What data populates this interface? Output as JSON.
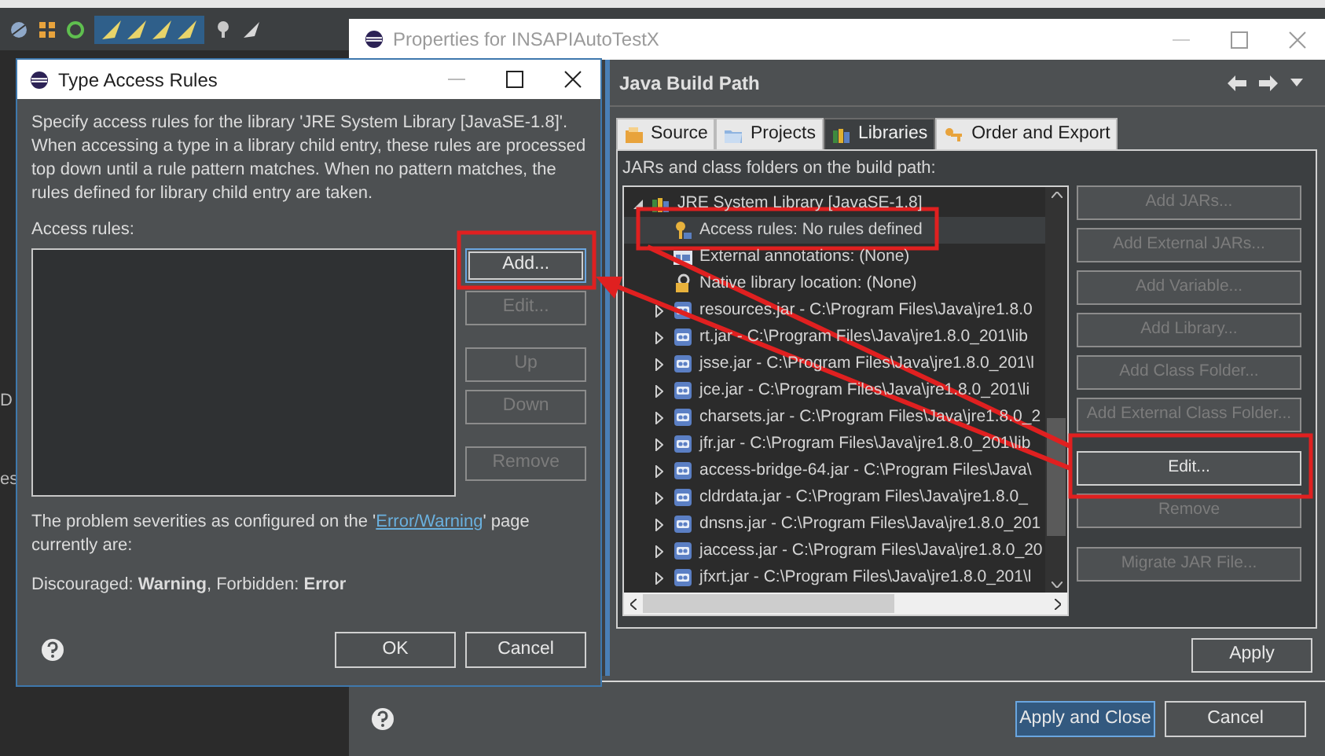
{
  "background": {
    "edge_texts": [
      "D",
      "es"
    ]
  },
  "properties_window": {
    "title": "Properties for INSAPIAutoTestX",
    "page_title": "Java Build Path",
    "tabs": [
      {
        "label": "Source",
        "kind": "source",
        "selected": false
      },
      {
        "label": "Projects",
        "kind": "projects",
        "selected": false
      },
      {
        "label": "Libraries",
        "kind": "libraries",
        "selected": true
      },
      {
        "label": "Order and Export",
        "kind": "order",
        "selected": false
      }
    ],
    "list_label": "JARs and class folders on the build path:",
    "tree": [
      {
        "label": "JRE System Library [JavaSE-1.8]",
        "kind": "library",
        "expanded": true,
        "selected": false,
        "children": [
          {
            "label": "Access rules: No rules defined",
            "kind": "rules",
            "selected": true
          },
          {
            "label": "External annotations: (None)",
            "kind": "annotations",
            "selected": false
          },
          {
            "label": "Native library location: (None)",
            "kind": "native",
            "selected": false
          },
          {
            "label": "resources.jar - C:\\Program Files\\Java\\jre1.8.0",
            "kind": "jar",
            "expanded": false,
            "selected": false
          },
          {
            "label": "rt.jar - C:\\Program Files\\Java\\jre1.8.0_201\\lib",
            "kind": "jar",
            "expanded": false,
            "selected": false
          },
          {
            "label": "jsse.jar - C:\\Program Files\\Java\\jre1.8.0_201\\l",
            "kind": "jar",
            "expanded": false,
            "selected": false
          },
          {
            "label": "jce.jar - C:\\Program Files\\Java\\jre1.8.0_201\\li",
            "kind": "jar",
            "expanded": false,
            "selected": false
          },
          {
            "label": "charsets.jar - C:\\Program Files\\Java\\jre1.8.0_2",
            "kind": "jar",
            "expanded": false,
            "selected": false
          },
          {
            "label": "jfr.jar - C:\\Program Files\\Java\\jre1.8.0_201\\lib",
            "kind": "jar",
            "expanded": false,
            "selected": false
          },
          {
            "label": "access-bridge-64.jar - C:\\Program Files\\Java\\",
            "kind": "jar",
            "expanded": false,
            "selected": false
          },
          {
            "label": "cldrdata.jar - C:\\Program Files\\Java\\jre1.8.0_",
            "kind": "jar",
            "expanded": false,
            "selected": false
          },
          {
            "label": "dnsns.jar - C:\\Program Files\\Java\\jre1.8.0_201",
            "kind": "jar",
            "expanded": false,
            "selected": false
          },
          {
            "label": "jaccess.jar - C:\\Program Files\\Java\\jre1.8.0_20",
            "kind": "jar",
            "expanded": false,
            "selected": false
          },
          {
            "label": "jfxrt.jar - C:\\Program Files\\Java\\jre1.8.0_201\\l",
            "kind": "jar",
            "expanded": false,
            "selected": false
          }
        ]
      }
    ],
    "side_buttons": [
      {
        "label": "Add JARs...",
        "disabled": true,
        "gap_before": false
      },
      {
        "label": "Add External JARs...",
        "disabled": true,
        "gap_before": false
      },
      {
        "label": "Add Variable...",
        "disabled": true,
        "gap_before": false
      },
      {
        "label": "Add Library...",
        "disabled": true,
        "gap_before": false
      },
      {
        "label": "Add Class Folder...",
        "disabled": true,
        "gap_before": false
      },
      {
        "label": "Add External Class Folder...",
        "disabled": true,
        "gap_before": false
      },
      {
        "label": "Edit...",
        "disabled": false,
        "gap_before": true
      },
      {
        "label": "Remove",
        "disabled": true,
        "gap_before": false
      },
      {
        "label": "Migrate JAR File...",
        "disabled": true,
        "gap_before": true
      }
    ],
    "apply": "Apply",
    "footer_buttons": [
      {
        "label": "Apply and Close",
        "default": true
      },
      {
        "label": "Cancel",
        "default": false
      }
    ]
  },
  "dialog": {
    "title": "Type Access Rules",
    "description": "Specify access rules for the library 'JRE System Library [JavaSE-1.8]'. When accessing a type in a library child entry, these rules are processed top down until a rule pattern matches. When no pattern matches, the rules defined for library child entry are taken.",
    "list_label": "Access rules:",
    "buttons": [
      {
        "label": "Add...",
        "disabled": false,
        "focused": true,
        "gap_before": false
      },
      {
        "label": "Edit...",
        "disabled": true,
        "focused": false,
        "gap_before": false
      },
      {
        "label": "Up",
        "disabled": true,
        "focused": false,
        "gap_before": true
      },
      {
        "label": "Down",
        "disabled": true,
        "focused": false,
        "gap_before": false
      },
      {
        "label": "Remove",
        "disabled": true,
        "focused": false,
        "gap_before": true
      }
    ],
    "severity_before": "The problem severities as configured on the '",
    "severity_link": "Error/Warning",
    "severity_after": "' page currently are:",
    "severity_values": "Discouraged: **Warning**, Forbidden: **Error**",
    "ok": "OK",
    "cancel": "Cancel"
  }
}
